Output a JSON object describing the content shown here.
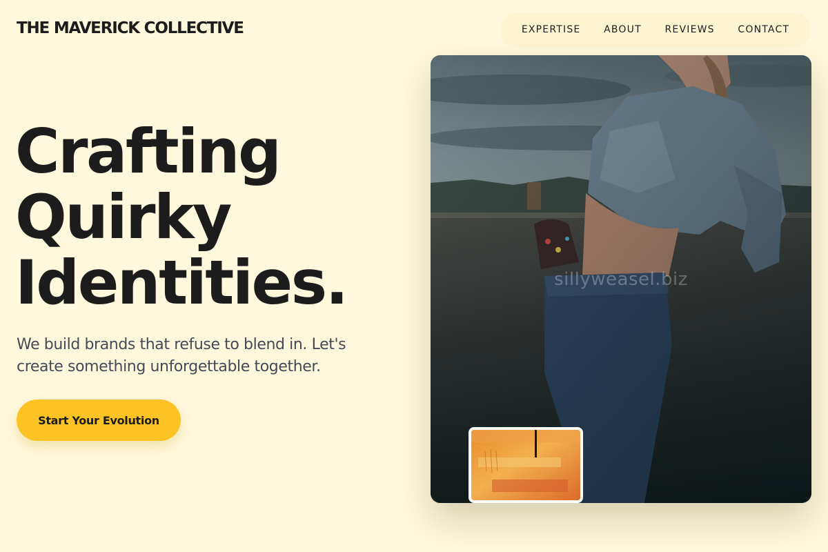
{
  "brand": {
    "name": "THE MAVERICK COLLECTIVE"
  },
  "nav": {
    "items": [
      {
        "label": "EXPERTISE"
      },
      {
        "label": "ABOUT"
      },
      {
        "label": "REVIEWS"
      },
      {
        "label": "CONTACT"
      }
    ]
  },
  "hero": {
    "headline_lines": [
      "Crafting",
      "Quirky",
      "Identities."
    ],
    "subtext": "We build brands that refuse to blend in. Let's create something unforgettable together.",
    "cta_label": "Start Your Evolution"
  },
  "photo": {
    "watermark": "sillyweasel.biz",
    "subject": "person in denim jacket leaning on concrete wall at dusk"
  },
  "thumbnail": {
    "subject": "orange textured abstract painting"
  },
  "colors": {
    "background": "#fef8dc",
    "accent": "#fbc324",
    "text": "#1c1c1c",
    "muted_text": "#454a55"
  }
}
